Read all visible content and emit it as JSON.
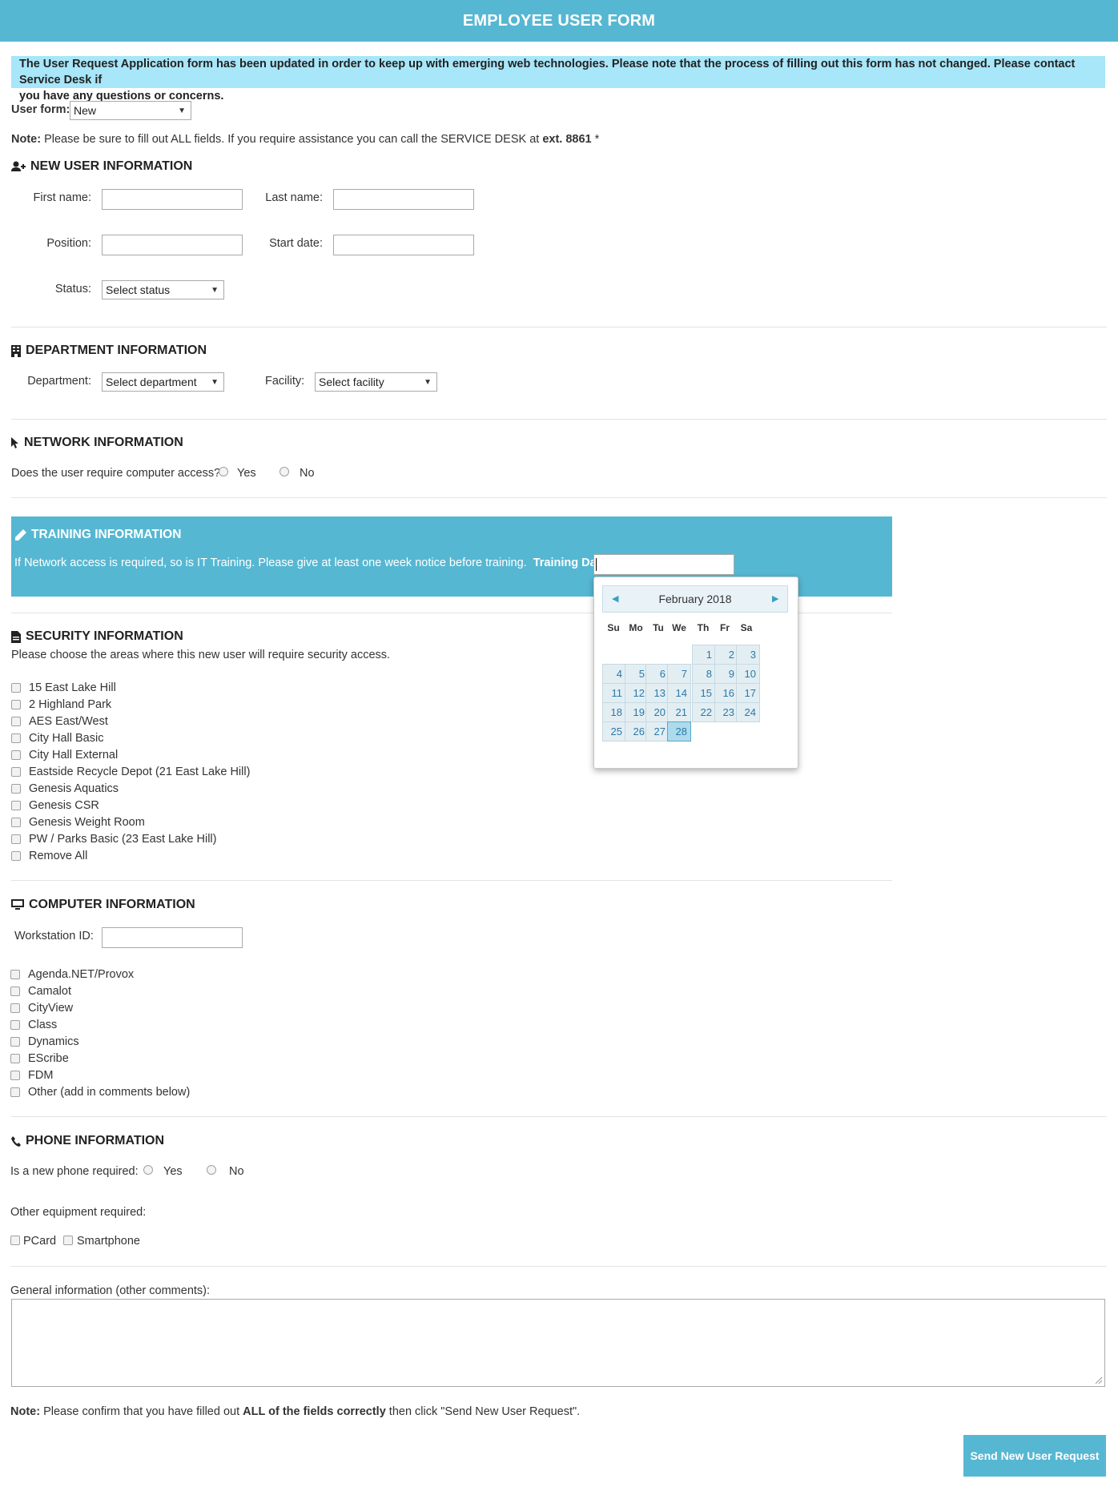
{
  "header": {
    "title": "EMPLOYEE USER FORM"
  },
  "notice": {
    "line1": "The User Request Application form has been updated in order to keep up with emerging web technologies. Please note that the process of filling out this form has not changed. Please contact Service Desk if",
    "line2": "you have any questions or concerns."
  },
  "user_form": {
    "label": "User form:",
    "value": "New"
  },
  "note_top": {
    "prefix": "Note:",
    "text": "Please be sure to fill out ALL fields. If you require assistance you can call the SERVICE DESK at",
    "ext": "ext. 8861",
    "suffix": "*"
  },
  "new_user": {
    "title": "NEW USER INFORMATION",
    "first_name": "First name:",
    "last_name": "Last name:",
    "position": "Position:",
    "start_date": "Start date:",
    "status_label": "Status:",
    "status_value": "Select status"
  },
  "department": {
    "title": "DEPARTMENT INFORMATION",
    "dept_label": "Department:",
    "dept_value": "Select department",
    "facility_label": "Facility:",
    "facility_value": "Select facility"
  },
  "network": {
    "title": "NETWORK INFORMATION",
    "question": "Does the user require computer access?",
    "yes": "Yes",
    "no": "No"
  },
  "training": {
    "title": "TRAINING INFORMATION",
    "text": "If Network access is required, so is IT Training. Please give at least one week notice before training.",
    "date_label": "Training Date:"
  },
  "calendar": {
    "month": "February 2018",
    "days_of_week": [
      "Su",
      "Mo",
      "Tu",
      "We",
      "Th",
      "Fr",
      "Sa"
    ],
    "days": [
      "1",
      "2",
      "3",
      "4",
      "5",
      "6",
      "7",
      "8",
      "9",
      "10",
      "11",
      "12",
      "13",
      "14",
      "15",
      "16",
      "17",
      "18",
      "19",
      "20",
      "21",
      "22",
      "23",
      "24",
      "25",
      "26",
      "27",
      "28"
    ],
    "active_day": "28"
  },
  "security": {
    "title": "SECURITY INFORMATION",
    "subtitle": "Please choose the areas where this new user will require security access.",
    "items": [
      "15 East Lake Hill",
      "2 Highland Park",
      "AES East/West",
      "City Hall Basic",
      "City Hall External",
      "Eastside Recycle Depot (21 East Lake Hill)",
      "Genesis Aquatics",
      "Genesis CSR",
      "Genesis Weight Room",
      "PW / Parks Basic (23 East Lake Hill)",
      "Remove All"
    ]
  },
  "computer": {
    "title": "COMPUTER INFORMATION",
    "workstation_label": "Workstation ID:",
    "items": [
      "Agenda.NET/Provox",
      "Camalot",
      "CityView",
      "Class",
      "Dynamics",
      "EScribe",
      "FDM",
      "Other (add in comments below)"
    ]
  },
  "phone": {
    "title": "PHONE INFORMATION",
    "question": "Is a new phone required:",
    "yes": "Yes",
    "no": "No",
    "other_label": "Other equipment required:",
    "pcard": "PCard",
    "smartphone": "Smartphone"
  },
  "comments": {
    "label": "General information (other comments):"
  },
  "note_bottom": {
    "prefix": "Note:",
    "text1": "Please confirm that you have filled out",
    "bold": "ALL of the fields correctly",
    "text2": "then click \"Send New User Request\"."
  },
  "submit": {
    "label": "Send New User Request"
  }
}
